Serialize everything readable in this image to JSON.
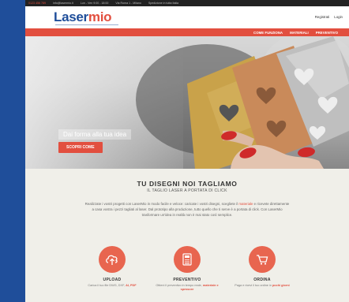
{
  "topbar": {
    "items": [
      "0123 456 789",
      "info@lasermio.it",
      "Lun - Ven 9:00 - 18:00",
      "Via Roma 1 - Milano",
      "Spedizione in tutta Italia"
    ]
  },
  "header": {
    "logo_part1": "Laser",
    "logo_part2": "mio",
    "register": "Registrati",
    "login": "Login"
  },
  "nav": {
    "items": [
      "COME FUNZIONA",
      "MATERIALI",
      "PREVENTIVO"
    ]
  },
  "hero": {
    "caption": "Dai forma alla tua idea",
    "cta": "SCOPRI COME"
  },
  "main": {
    "title": "TU DISEGNI NOI TAGLIAMO",
    "subtitle": "IL TAGLIO LASER A PORTATA DI CLICK",
    "intro_1": "Realizzate i vostri progetti con LaserMio in modo facile e veloce: caricate i vostri disegni, scegliete il ",
    "intro_hl": "materiale",
    "intro_2": " e ricevete direttamente a casa vostra i pezzi tagliati al laser. Dal prototipo alla produzione, tutto quello che ti serve è a portata di click. Con LaserMio trasformare un'idea in realtà non è mai stato così semplice."
  },
  "features": [
    {
      "title": "UPLOAD",
      "desc": "Carica il tuo file DWG, DXF, ",
      "desc_bold": "AI, PDF"
    },
    {
      "title": "PREVENTIVO",
      "desc": "Ottieni il preventivo in tempo reale, ",
      "desc_bold": "materiale e spessore"
    },
    {
      "title": "ORDINA",
      "desc": "Paga e ricevi il tuo ordine in ",
      "desc_bold": "pochi giorni"
    }
  ],
  "colors": {
    "accent": "#e24f3f",
    "brand_blue": "#1f4e9a",
    "topbar": "#222222"
  }
}
